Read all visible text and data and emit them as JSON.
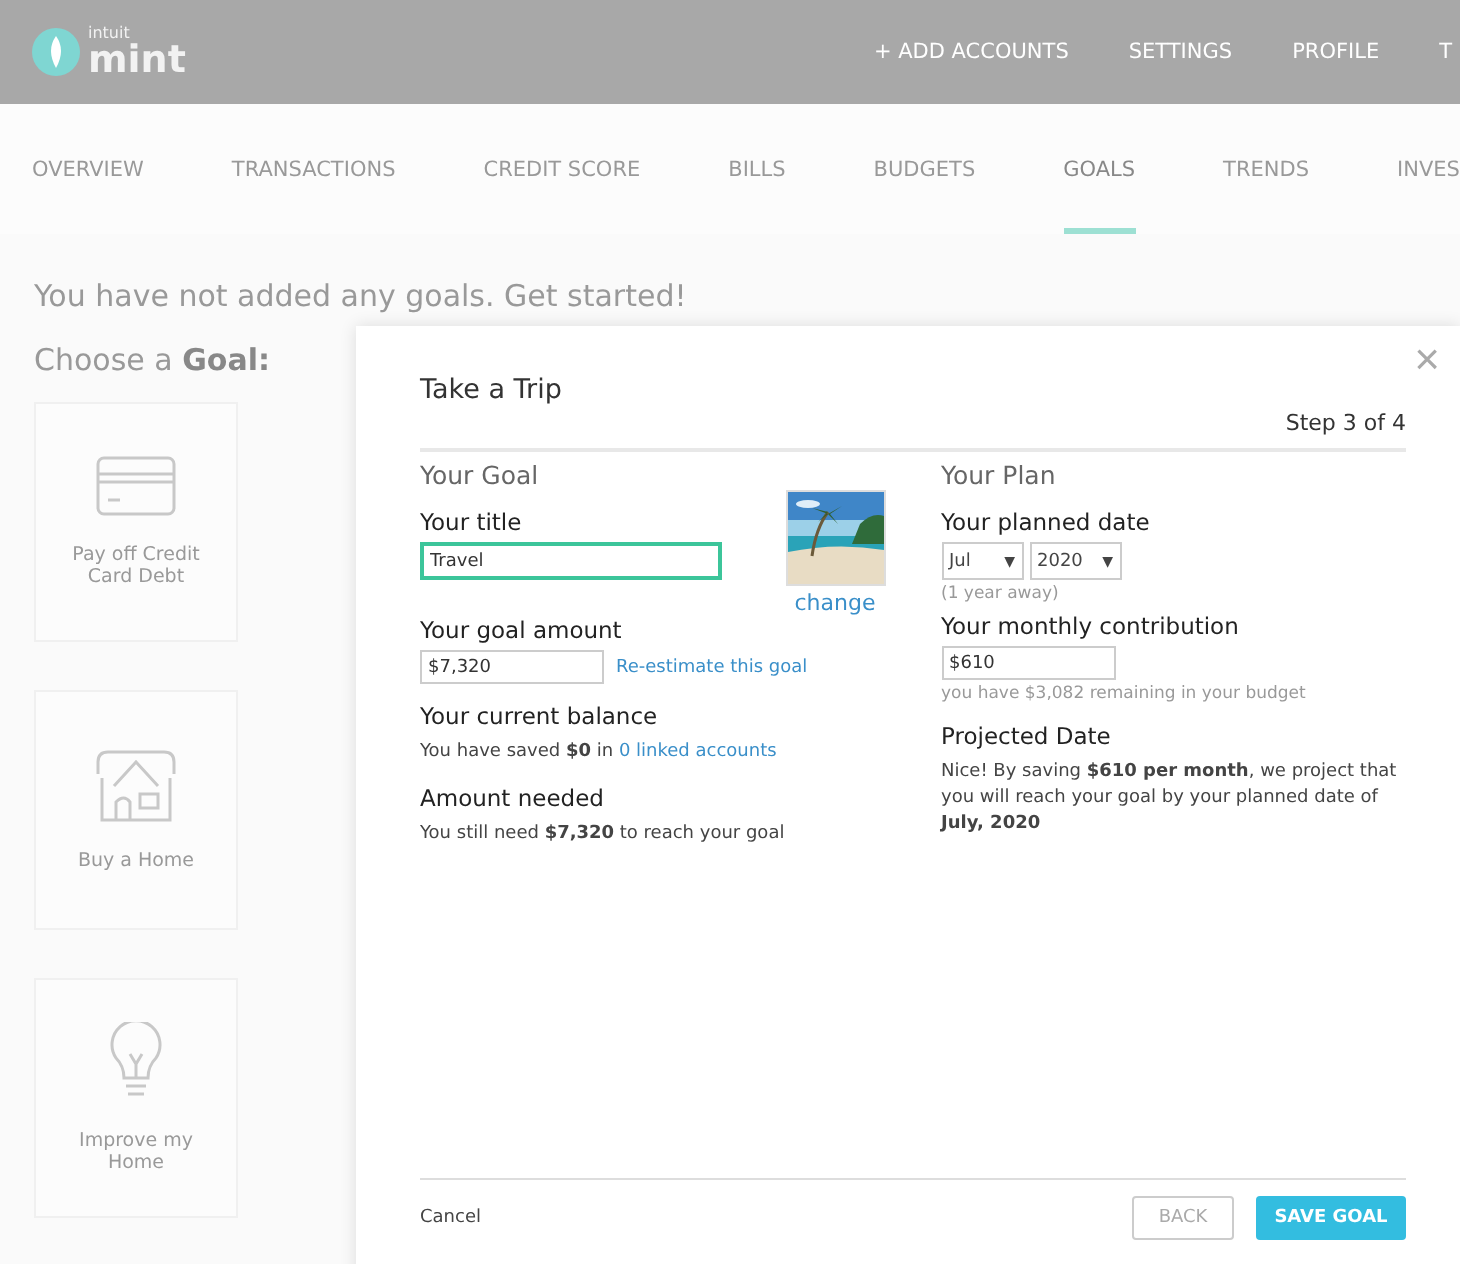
{
  "header": {
    "logo_small": "intuit",
    "logo": "mint",
    "links": [
      "+ ADD ACCOUNTS",
      "SETTINGS",
      "PROFILE",
      "T"
    ]
  },
  "nav": [
    {
      "label": "OVERVIEW",
      "selected": false
    },
    {
      "label": "TRANSACTIONS",
      "selected": false
    },
    {
      "label": "CREDIT SCORE",
      "selected": false
    },
    {
      "label": "BILLS",
      "selected": false
    },
    {
      "label": "BUDGETS",
      "selected": false
    },
    {
      "label": "GOALS",
      "selected": true
    },
    {
      "label": "TRENDS",
      "selected": false
    },
    {
      "label": "INVES",
      "selected": false
    }
  ],
  "intro": "You have not added any goals. Get started!",
  "choose": "Choose a **Goal:**",
  "goal_cards": [
    {
      "kind": "card",
      "label": "Pay off Credit Card Debt"
    },
    {
      "kind": "home",
      "label": "Buy a Home"
    },
    {
      "kind": "bulb",
      "label": "Improve my Home"
    }
  ],
  "dialog": {
    "title": "Take a Trip",
    "close": "×",
    "step": "Step 3 of 4",
    "goal": {
      "heading": "Your Goal",
      "title_label": "Your title",
      "title_value": "Travel",
      "change": "change",
      "amount_label": "Your goal amount",
      "amount_value": "$7,320",
      "reestimate": "Re-estimate this goal",
      "balance_label": "Your current balance",
      "balance_text": "You have saved **$0** in",
      "linked": "0 linked accounts",
      "needed_label": "Amount needed",
      "needed_text": "You still need **$7,320** to reach your goal"
    },
    "plan": {
      "heading": "Your Plan",
      "date_label": "Your planned date",
      "month": "Jul",
      "year": "2020",
      "select_arrow": "▼",
      "away": "(1 year away)",
      "contribution_label": "Your monthly contribution",
      "contribution_value": "$610",
      "remaining": "you have $3,082 remaining in your budget",
      "projected_label": "Projected Date",
      "projected_text": "Nice! By saving **$610 per month**, we project that you will reach your goal by your planned date of **July, 2020**"
    },
    "cancel": "Cancel",
    "back": "BACK",
    "save": "SAVE GOAL"
  }
}
